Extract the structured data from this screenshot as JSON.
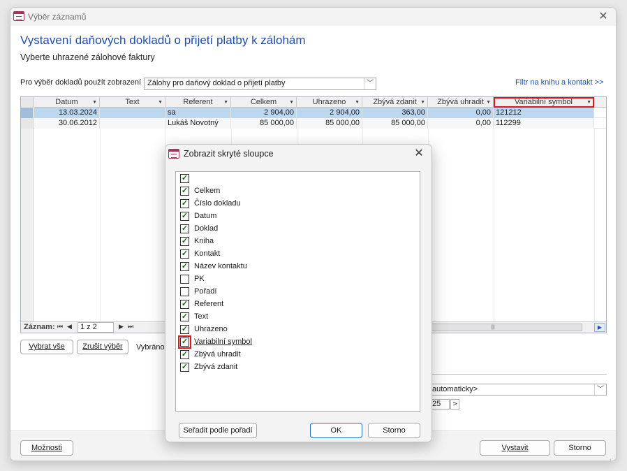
{
  "window": {
    "title": "Výběr záznamů",
    "heading": "Vystavení daňových dokladů o přijetí platby k zálohám",
    "subheading": "Vyberte uhrazené zálohové faktury"
  },
  "view": {
    "label": "Pro výběr dokladů použít zobrazení",
    "selected": "Zálohy pro daňový doklad o přijetí platby",
    "filter_link": "Filtr na knihu a kontakt >>"
  },
  "grid": {
    "columns": [
      "Datum",
      "Text",
      "Referent",
      "Celkem",
      "Uhrazeno",
      "Zbývá zdanit",
      "Zbývá uhradit",
      "Variabilní symbol"
    ],
    "rows": [
      [
        "13.03.2024",
        "",
        "sa",
        "2 904,00",
        "2 904,00",
        "363,00",
        "0,00",
        "121212"
      ],
      [
        "30.06.2012",
        "",
        "Lukáš Novotný",
        "85 000,00",
        "85 000,00",
        "85 000,00",
        "0,00",
        "112299"
      ]
    ],
    "record_label": "Záznam:",
    "record_position": "1 z 2",
    "nav_first": "⏮",
    "nav_prev": "◀",
    "nav_next": "▶",
    "nav_last": "⏭"
  },
  "buttons": {
    "select_all": "Vybrat vše",
    "cancel_selection": "Zrušit výběr",
    "selected_label": "Vybráno",
    "options": "Možnosti",
    "issue": "Vystavit",
    "cancel": "Storno"
  },
  "numbering": {
    "auto_value": "automaticky>",
    "page_value": "25"
  },
  "dialog": {
    "title": "Zobrazit skryté sloupce",
    "items": [
      {
        "label": "",
        "checked": true
      },
      {
        "label": "Celkem",
        "checked": true
      },
      {
        "label": "Číslo dokladu",
        "checked": true
      },
      {
        "label": "Datum",
        "checked": true
      },
      {
        "label": "Doklad",
        "checked": true
      },
      {
        "label": "Kniha",
        "checked": true
      },
      {
        "label": "Kontakt",
        "checked": true
      },
      {
        "label": "Název kontaktu",
        "checked": true
      },
      {
        "label": "PK",
        "checked": false
      },
      {
        "label": "Pořadí",
        "checked": false
      },
      {
        "label": "Referent",
        "checked": true
      },
      {
        "label": "Text",
        "checked": true
      },
      {
        "label": "Uhrazeno",
        "checked": true
      },
      {
        "label": "Variabilní symbol",
        "checked": true
      },
      {
        "label": "Zbývá uhradit",
        "checked": true
      },
      {
        "label": "Zbývá zdanit",
        "checked": true
      }
    ],
    "sort_button": "Seřadit podle pořadí",
    "ok_button": "OK",
    "cancel_button": "Storno"
  }
}
